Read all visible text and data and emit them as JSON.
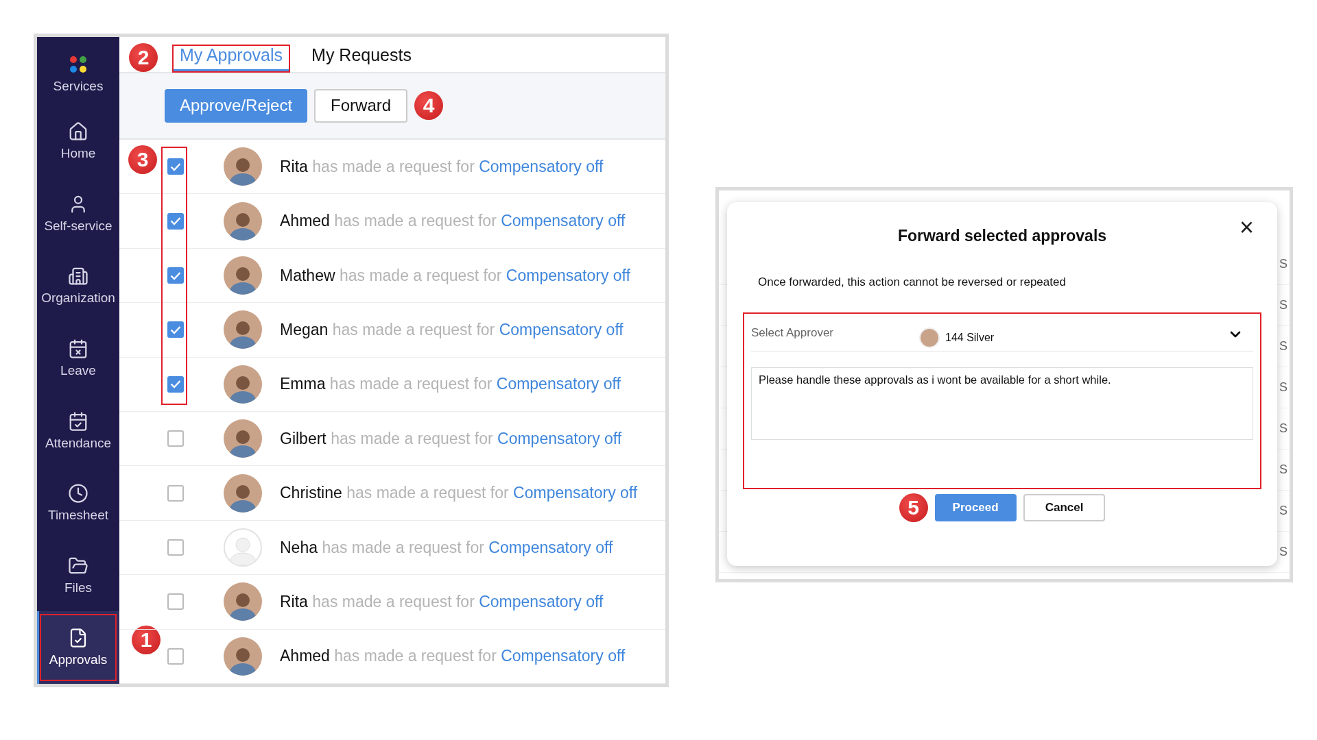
{
  "sidebar": {
    "logo_label": "Services",
    "callout": "1",
    "items": [
      {
        "label": "Home",
        "selected": false,
        "highlighted": false
      },
      {
        "label": "Self-service",
        "selected": false,
        "highlighted": false
      },
      {
        "label": "Organization",
        "selected": false,
        "highlighted": false
      },
      {
        "label": "Leave",
        "selected": false,
        "highlighted": false
      },
      {
        "label": "Attendance",
        "selected": false,
        "highlighted": false
      },
      {
        "label": "Timesheet",
        "selected": false,
        "highlighted": false
      },
      {
        "label": "Files",
        "selected": false,
        "highlighted": false
      },
      {
        "label": "Approvals",
        "selected": true,
        "highlighted": true
      }
    ]
  },
  "tabs": {
    "callout": "2",
    "items": [
      {
        "label": "My Approvals",
        "selected": true,
        "highlighted": true
      },
      {
        "label": "My Requests",
        "selected": false,
        "highlighted": false
      }
    ]
  },
  "toolbar": {
    "callout": "4",
    "buttons": [
      {
        "label": "Approve/Reject",
        "kind": "primary"
      },
      {
        "label": "Forward",
        "kind": "secondary"
      }
    ]
  },
  "requests": {
    "callout": "3",
    "rows": [
      {
        "name": "Rita",
        "text": "has made a request for",
        "link": "Compensatory off",
        "checked": true,
        "highlighted": true,
        "photo": true
      },
      {
        "name": "Ahmed",
        "text": "has made a request for",
        "link": "Compensatory off",
        "checked": true,
        "highlighted": true,
        "photo": true
      },
      {
        "name": "Mathew",
        "text": "has made a request for",
        "link": "Compensatory off",
        "checked": true,
        "highlighted": true,
        "photo": true
      },
      {
        "name": "Megan",
        "text": "has made a request for",
        "link": "Compensatory off",
        "checked": true,
        "highlighted": true,
        "photo": true
      },
      {
        "name": "Emma",
        "text": "has made a request for",
        "link": "Compensatory off",
        "checked": true,
        "highlighted": true,
        "photo": true
      },
      {
        "name": "Gilbert",
        "text": "has made a request for",
        "link": "Compensatory off",
        "checked": false,
        "highlighted": false,
        "photo": true
      },
      {
        "name": "Christine",
        "text": "has made a request for",
        "link": "Compensatory off",
        "checked": false,
        "highlighted": false,
        "photo": true
      },
      {
        "name": "Neha",
        "text": "has made a request for",
        "link": "Compensatory off",
        "checked": false,
        "highlighted": false,
        "photo": false
      },
      {
        "name": "Rita",
        "text": "has made a request for",
        "link": "Compensatory off",
        "checked": false,
        "highlighted": false,
        "photo": true
      },
      {
        "name": "Ahmed",
        "text": "has made a request for",
        "link": "Compensatory off",
        "checked": false,
        "highlighted": false,
        "photo": true
      }
    ]
  },
  "background_rows": [
    {
      "right": "S"
    },
    {
      "right": "S"
    },
    {
      "right": "S"
    },
    {
      "right": "S"
    },
    {
      "right": "S"
    },
    {
      "right": "S"
    },
    {
      "right": "S"
    },
    {
      "right": "S"
    }
  ],
  "dialog": {
    "title": "Forward selected approvals",
    "close": "×",
    "message": "Once forwarded, this action cannot be reversed or repeated",
    "highlighted": true,
    "approver": {
      "label": "Select Approver",
      "value": "144 Silver"
    },
    "note": "Please handle these approvals as i wont be available for a short while.",
    "callout": "5",
    "buttons": [
      {
        "label": "Proceed",
        "kind": "primary"
      },
      {
        "label": "Cancel",
        "kind": "secondary"
      }
    ]
  }
}
